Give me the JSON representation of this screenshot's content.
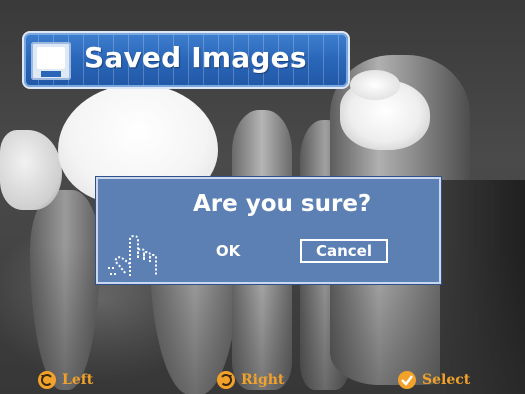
{
  "header": {
    "title": "Saved Images",
    "icon": "floppy-disk-icon"
  },
  "dialog": {
    "question": "Are you sure?",
    "ok_label": "OK",
    "cancel_label": "Cancel",
    "selected": "Cancel",
    "hand_icon": "pointing-hand-icon"
  },
  "footer": {
    "left": {
      "label": "Left",
      "icon": "rotate-left-icon"
    },
    "right": {
      "label": "Right",
      "icon": "rotate-right-icon"
    },
    "select": {
      "label": "Select",
      "icon": "checkmark-icon"
    }
  },
  "colors": {
    "header_blue": "#2a66b8",
    "dialog_blue": "#5c80b4",
    "footer_orange": "#f2a22a"
  }
}
